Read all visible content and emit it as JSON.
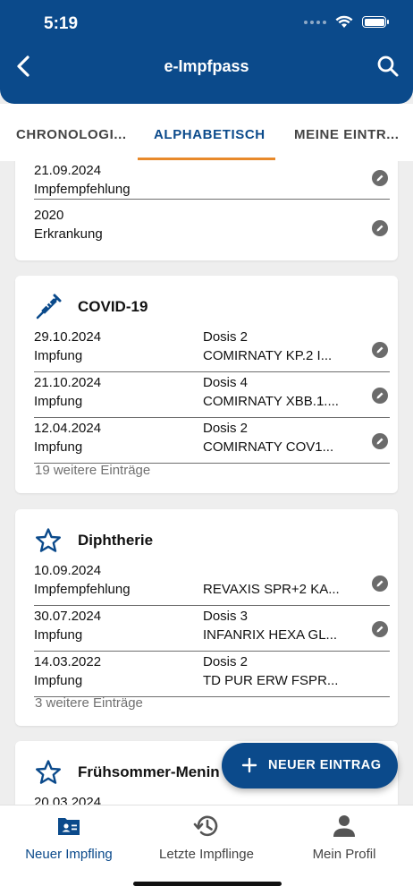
{
  "status_bar": {
    "time": "5:19"
  },
  "header": {
    "title": "e-Impfpass"
  },
  "tabs": [
    {
      "label": "CHRONOLOGI..."
    },
    {
      "label": "ALPHABETISCH"
    },
    {
      "label": "MEINE EINTR..."
    }
  ],
  "cards": [
    {
      "title": "",
      "rows": [
        {
          "date": "21.09.2024",
          "type": "Impfempfehlung",
          "dose": "",
          "product": ""
        },
        {
          "date": "2020",
          "type": "Erkrankung",
          "dose": "",
          "product": ""
        }
      ],
      "more": ""
    },
    {
      "title": "COVID-19",
      "rows": [
        {
          "date": "29.10.2024",
          "type": "Impfung",
          "dose": "Dosis 2",
          "product": "COMIRNATY KP.2 I..."
        },
        {
          "date": "21.10.2024",
          "type": "Impfung",
          "dose": "Dosis 4",
          "product": "COMIRNATY XBB.1...."
        },
        {
          "date": "12.04.2024",
          "type": "Impfung",
          "dose": "Dosis 2",
          "product": "COMIRNATY COV1..."
        }
      ],
      "more": "19 weitere Einträge"
    },
    {
      "title": "Diphtherie",
      "rows": [
        {
          "date": "10.09.2024",
          "type": "Impfempfehlung",
          "dose": "",
          "product": "REVAXIS SPR+2 KA..."
        },
        {
          "date": "30.07.2024",
          "type": "Impfung",
          "dose": "Dosis 3",
          "product": "INFANRIX HEXA GL..."
        },
        {
          "date": "14.03.2022",
          "type": "Impfung",
          "dose": "Dosis 2",
          "product": "TD PUR ERW FSPR..."
        }
      ],
      "more": "3 weitere Einträge"
    },
    {
      "title": "Frühsommer-Menin",
      "rows": [
        {
          "date": "20.03.2024",
          "type": "",
          "dose": "",
          "product": ""
        }
      ],
      "more": ""
    }
  ],
  "fab": {
    "label": "NEUER EINTRAG"
  },
  "bottom_nav": [
    {
      "label": "Neuer Impfling"
    },
    {
      "label": "Letzte Impflinge"
    },
    {
      "label": "Mein Profil"
    }
  ],
  "colors": {
    "primary": "#0b4a8b",
    "accent": "#e8892a",
    "muted_text": "#707070"
  },
  "icons": {
    "header": [
      "back-arrow-icon",
      "search-icon"
    ],
    "card_icons": [
      "syringe-icon",
      "star-outline-icon"
    ],
    "row_action": "pencil-icon",
    "bottom_nav": [
      "id-card-icon",
      "history-icon",
      "person-icon"
    ]
  }
}
